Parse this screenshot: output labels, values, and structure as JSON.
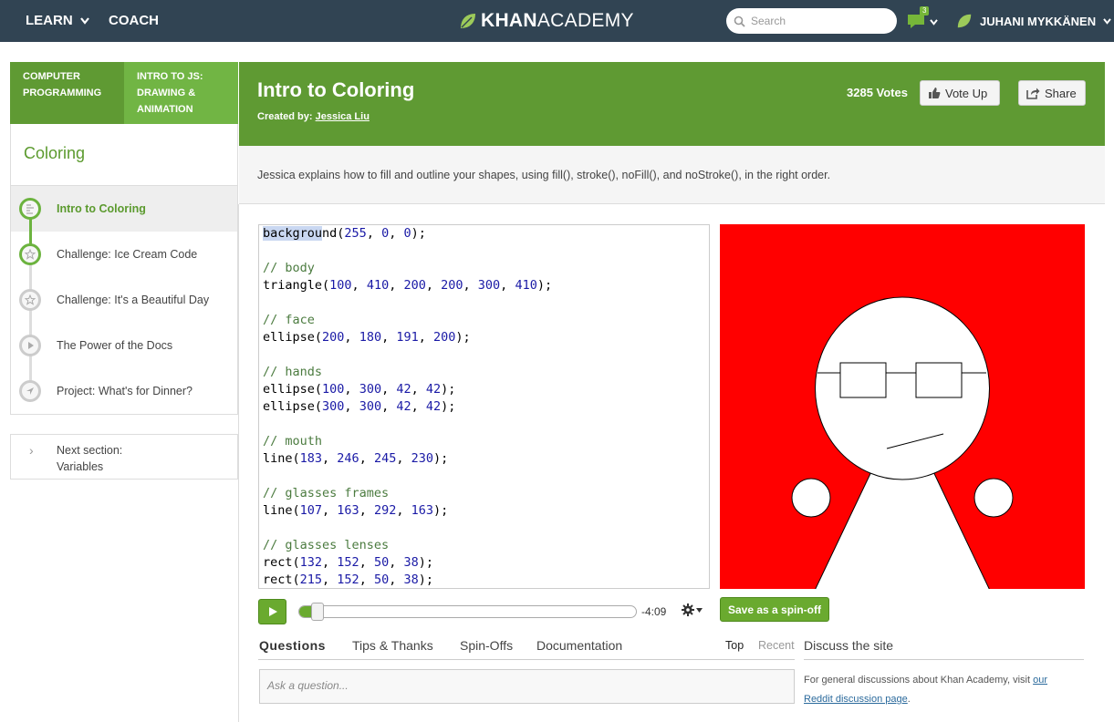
{
  "nav": {
    "learn": "LEARN",
    "coach": "COACH",
    "logo_bold": "KHAN",
    "logo_rest": "ACADEMY",
    "search_placeholder": "Search",
    "notification_count": "3",
    "user_name": "JUHANI MYKKÄNEN"
  },
  "sidebar": {
    "crumbs": [
      "COMPUTER PROGRAMMING",
      "INTRO TO JS: DRAWING & ANIMATION"
    ],
    "section_title": "Coloring",
    "items": [
      {
        "label": "Intro to Coloring",
        "icon": "talkthrough-icon"
      },
      {
        "label": "Challenge: Ice Cream Code",
        "icon": "star-icon"
      },
      {
        "label": "Challenge: It's a Beautiful Day",
        "icon": "star-icon"
      },
      {
        "label": "The Power of the Docs",
        "icon": "play-icon"
      },
      {
        "label": "Project: What's for Dinner?",
        "icon": "compass-icon"
      }
    ],
    "next_section_label": "Next section:",
    "next_section_name": "Variables"
  },
  "header": {
    "title": "Intro to Coloring",
    "created_by_label": "Created by:",
    "author": "Jessica Liu",
    "votes": "3285 Votes",
    "vote_up": "Vote Up",
    "share": "Share"
  },
  "description": "Jessica explains how to fill and outline your shapes, using fill(), stroke(), noFill(), and noStroke(), in the right order.",
  "code": [
    "background(255, 0, 0);",
    "",
    "// body",
    "triangle(100, 410, 200, 200, 300, 410);",
    "",
    "// face",
    "ellipse(200, 180, 191, 200);",
    "",
    "// hands",
    "ellipse(100, 300, 42, 42);",
    "ellipse(300, 300, 42, 42);",
    "",
    "// mouth",
    "line(183, 246, 245, 230);",
    "",
    "// glasses frames",
    "line(107, 163, 292, 163);",
    "",
    "// glasses lenses",
    "rect(132, 152, 50, 38);",
    "rect(215, 152, 50, 38);"
  ],
  "player": {
    "time": "-4:09",
    "progress": 0.05,
    "spin_off": "Save as a spin-off"
  },
  "tabs": {
    "items": [
      "Questions",
      "Tips & Thanks",
      "Spin-Offs",
      "Documentation"
    ],
    "sort_top": "Top",
    "sort_recent": "Recent",
    "ask_placeholder": "Ask a question..."
  },
  "discuss": {
    "title": "Discuss the site",
    "text": "For general discussions about Khan Academy, visit",
    "link1": "our",
    "link2": "Reddit discussion page",
    "period": "."
  },
  "colors": {
    "topbar": "#314453",
    "green": "#5f9a33",
    "canvas_bg": "#ff0000"
  }
}
